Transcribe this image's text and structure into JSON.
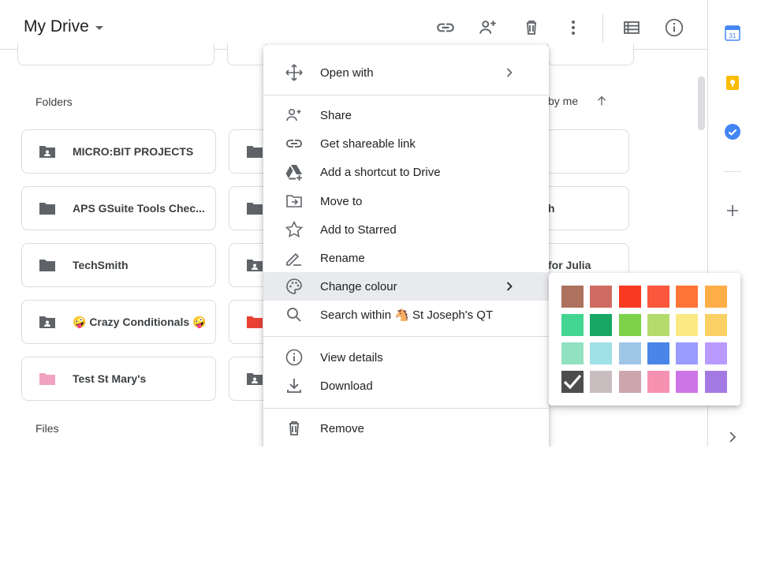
{
  "header": {
    "title": "My Drive"
  },
  "folders_section": {
    "label": "Folders",
    "sort_label": "by me"
  },
  "files_section": {
    "label": "Files"
  },
  "folders": [
    {
      "name": "MICRO:BIT PROJECTS",
      "type": "shared",
      "color": "#5f6368"
    },
    {
      "name": "APS GSuite Tools Chec...",
      "type": "plain",
      "color": "#5f6368"
    },
    {
      "name": "TechSmith",
      "type": "plain",
      "color": "#5f6368"
    },
    {
      "name": "🤪 Crazy Conditionals 🤪",
      "type": "shared",
      "color": "#5f6368"
    },
    {
      "name": "Test St Mary's",
      "type": "plain",
      "color": "#f0a3c0"
    }
  ],
  "partial_folders": [
    {
      "text": "h"
    },
    {
      "text": "for Julia"
    }
  ],
  "context_menu": {
    "open_with": "Open with",
    "share": "Share",
    "get_link": "Get shareable link",
    "add_shortcut": "Add a shortcut to Drive",
    "move_to": "Move to",
    "add_starred": "Add to Starred",
    "rename": "Rename",
    "change_colour": "Change colour",
    "search_within": "Search within 🐴 St Joseph's QT",
    "view_details": "View details",
    "download": "Download",
    "remove": "Remove"
  },
  "palette": {
    "selected": "#4d4d4d",
    "colors": [
      "#ac725e",
      "#d06b64",
      "#f83a22",
      "#fa573c",
      "#ff7537",
      "#ffad46",
      "#42d692",
      "#16a765",
      "#7bd148",
      "#b3dc6c",
      "#fbe983",
      "#fad165",
      "#92e1c0",
      "#9fe1e7",
      "#9fc6e7",
      "#4986e7",
      "#9a9cff",
      "#b99aff",
      "#4d4d4d",
      "#cabdbf",
      "#cca6ac",
      "#f691b2",
      "#cd74e6",
      "#a47ae2"
    ]
  },
  "side_panel": {
    "calendar_day": "31"
  }
}
